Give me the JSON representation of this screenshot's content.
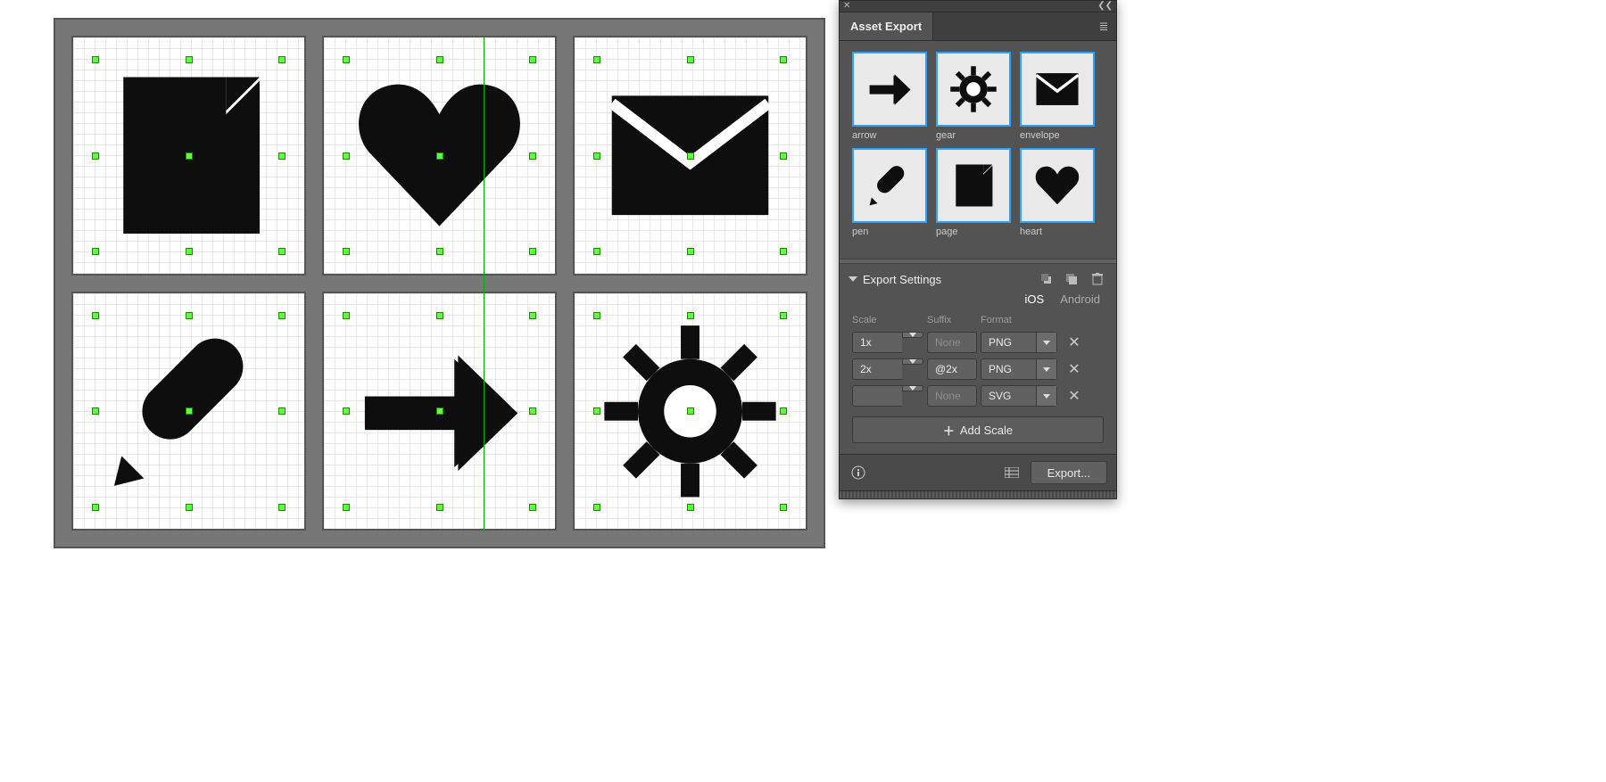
{
  "panel": {
    "title": "Asset Export",
    "assets": [
      {
        "name": "arrow",
        "icon": "arrow"
      },
      {
        "name": "gear",
        "icon": "gear"
      },
      {
        "name": "envelope",
        "icon": "envelope"
      },
      {
        "name": "pen",
        "icon": "pen"
      },
      {
        "name": "page",
        "icon": "page"
      },
      {
        "name": "heart",
        "icon": "heart"
      }
    ],
    "export_settings_label": "Export Settings",
    "platforms": {
      "ios": "iOS",
      "android": "Android"
    },
    "columns": {
      "scale": "Scale",
      "suffix": "Suffix",
      "format": "Format"
    },
    "rows": [
      {
        "scale": "1x",
        "suffix": "None",
        "suffix_placeholder": true,
        "format": "PNG"
      },
      {
        "scale": "2x",
        "suffix": "@2x",
        "suffix_placeholder": false,
        "format": "PNG"
      },
      {
        "scale": "",
        "suffix": "None",
        "suffix_placeholder": true,
        "format": "SVG"
      }
    ],
    "add_scale_label": "Add Scale",
    "export_button_label": "Export..."
  }
}
